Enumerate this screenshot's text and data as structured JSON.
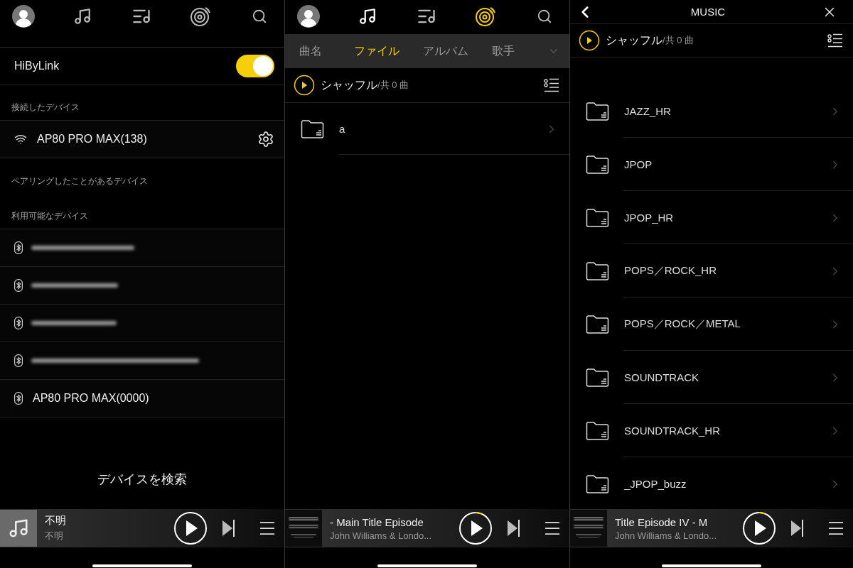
{
  "panels": [
    {
      "kind": "devices",
      "nav": [
        {
          "kind": "avatar",
          "selected": false
        },
        {
          "kind": "note",
          "selected": false
        },
        {
          "kind": "playlist",
          "selected": false
        },
        {
          "kind": "disc",
          "selected": false
        },
        {
          "kind": "search",
          "selected": false
        }
      ],
      "toggle": {
        "label": "HiByLink",
        "on": true
      },
      "sections": [
        {
          "title": "接続したデバイス",
          "devices": [
            {
              "kind": "wifi",
              "name": "AP80 PRO MAX(138)",
              "settings": true
            }
          ]
        },
        {
          "title": "ペアリングしたことがあるデバイス"
        },
        {
          "title": "利用可能なデバイス",
          "devices": [
            {
              "kind": "bluetooth",
              "blurred": true
            },
            {
              "kind": "bluetooth",
              "blurred": true
            },
            {
              "kind": "bluetooth",
              "blurred": true
            },
            {
              "kind": "bluetooth",
              "blurred": true
            },
            {
              "kind": "bluetooth",
              "name": "AP80 PRO MAX(0000)",
              "blurred": false,
              "settings": false
            }
          ]
        }
      ],
      "search_button": "デバイスを検索",
      "player": {
        "kind": "note",
        "title": "不明",
        "artist": "不明",
        "level": 0
      }
    },
    {
      "kind": "browser",
      "nav": [
        {
          "kind": "avatar",
          "selected": false
        },
        {
          "kind": "note",
          "selected": false
        },
        {
          "kind": "playlist",
          "selected": false
        },
        {
          "kind": "disc",
          "selected": true
        },
        {
          "kind": "search",
          "selected": false
        }
      ],
      "tabs": [
        {
          "label": "曲名",
          "selected": false
        },
        {
          "label": "ファイル",
          "selected": true
        },
        {
          "label": "アルバム",
          "selected": false
        },
        {
          "label": "歌手",
          "selected": false
        }
      ],
      "shuffle": {
        "label": "シャッフル",
        "count": "/共 0 曲"
      },
      "folders": [
        "a"
      ],
      "player": {
        "kind": "picture",
        "title": "- Main Title  Episode",
        "artist": "John Williams & Londo...",
        "level": 0.06
      }
    },
    {
      "kind": "folder",
      "header": {
        "title": "MUSIC"
      },
      "shuffle": {
        "label": "シャッフル",
        "count": "/共 0 曲"
      },
      "folders": [
        "JAZZ_HR",
        "JPOP",
        "JPOP_HR",
        "POPS／ROCK_HR",
        "POPS／ROCK／METAL",
        "SOUNDTRACK",
        "SOUNDTRACK_HR",
        "_JPOP_buzz"
      ],
      "player": {
        "kind": "picture",
        "title": "Title  Episode IV - M",
        "artist": "John Williams & Londo...",
        "level": 0.06
      }
    }
  ]
}
